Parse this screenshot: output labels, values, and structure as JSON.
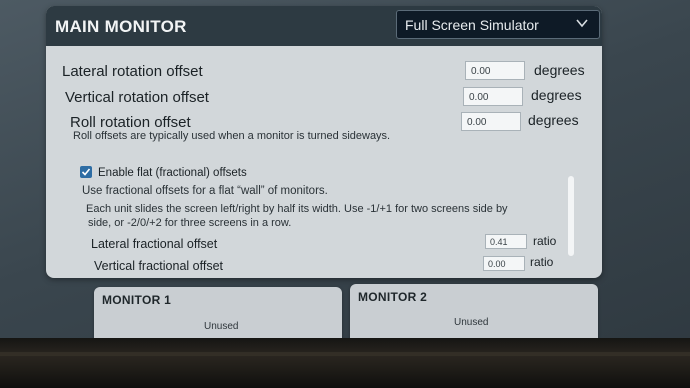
{
  "panel": {
    "title": "MAIN MONITOR",
    "dropdown": {
      "selected": "Full Screen Simulator"
    }
  },
  "rotation": {
    "lateral": {
      "label": "Lateral rotation offset",
      "value": "0.00",
      "unit": "degrees"
    },
    "vertical": {
      "label": "Vertical rotation offset",
      "value": "0.00",
      "unit": "degrees"
    },
    "roll": {
      "label": "Roll rotation offset",
      "value": "0.00",
      "unit": "degrees"
    },
    "roll_help": "Roll offsets are typically used when a monitor is turned sideways."
  },
  "fractional": {
    "checkbox_label": "Enable flat (fractional) offsets",
    "checked": true,
    "help1": "Use fractional offsets for a flat “wall” of monitors.",
    "help2_line1": "Each unit slides the screen left/right by half its width. Use -1/+1 for two screens side by",
    "help2_line2": "side, or -2/0/+2 for three screens in a row.",
    "lateral": {
      "label": "Lateral fractional offset",
      "value": "0.41",
      "unit": "ratio"
    },
    "vertical": {
      "label": "Vertical fractional offset",
      "value": "0.00",
      "unit": "ratio"
    }
  },
  "monitors": [
    {
      "title": "MONITOR 1",
      "status": "Unused"
    },
    {
      "title": "MONITOR 2",
      "status": "Unused"
    }
  ],
  "colors": {
    "header": "#2d3a42",
    "panel": "#d2d7da",
    "dropdown": "#0e1a26",
    "checkbox": "#2e6da4"
  },
  "icons": {
    "dropdown": "chevron-down-icon",
    "checkbox": "checkmark-icon"
  }
}
